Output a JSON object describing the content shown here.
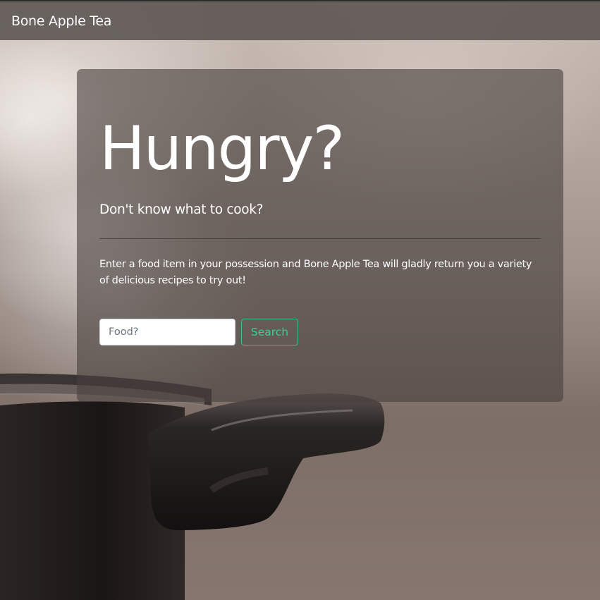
{
  "navbar": {
    "brand": "Bone Apple Tea"
  },
  "hero": {
    "headline": "Hungry?",
    "lead": "Don't know what to cook?",
    "description": "Enter a food item in your possession and Bone Apple Tea will gladly return you a variety of delicious recipes to try out!"
  },
  "search": {
    "placeholder": "Food?",
    "value": "",
    "button_label": "Search"
  },
  "colors": {
    "accent": "#3ccf8f",
    "navbar_bg": "#504a48",
    "panel_bg": "#48403e"
  },
  "background": {
    "subject": "steaming cooking pot"
  }
}
